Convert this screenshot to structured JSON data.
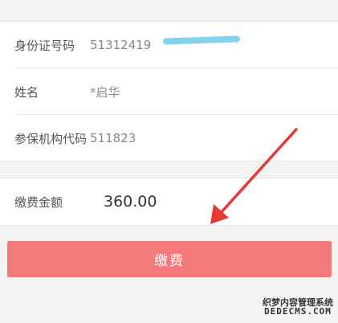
{
  "form": {
    "rows": [
      {
        "label": "身份证号码",
        "value": "51312419"
      },
      {
        "label": "姓名",
        "value": "*启华"
      },
      {
        "label": "参保机构代码",
        "value": "511823"
      }
    ]
  },
  "payment": {
    "label": "缴费金额",
    "amount": "360.00"
  },
  "actions": {
    "pay_label": "缴费"
  },
  "watermark": {
    "line1": "织梦内容管理系统",
    "line2": "DEDECMS.COM"
  },
  "colors": {
    "button": "#f47a7a",
    "arrow": "#e53935",
    "redaction": "#7ed0ee"
  },
  "icons": {
    "annotation": "red-arrow-icon"
  }
}
